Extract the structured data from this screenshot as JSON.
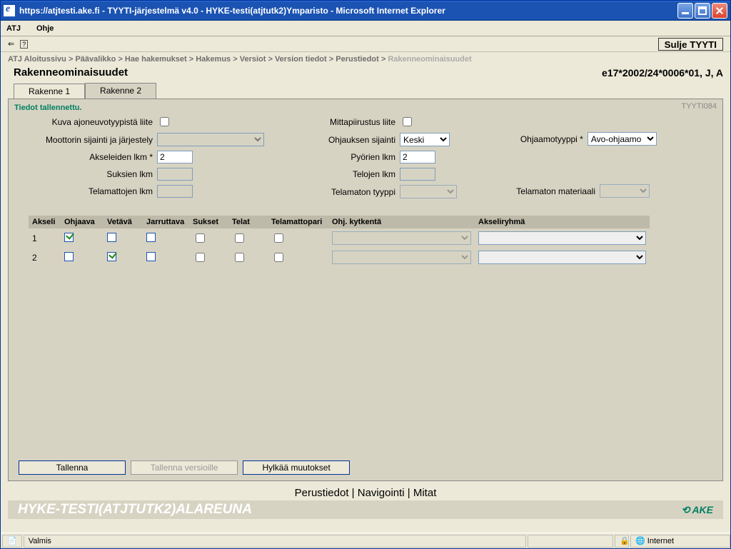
{
  "window_title": "https://atjtesti.ake.fi - TYYTI-järjestelmä v4.0 - HYKE-testi(atjtutk2)Ymparisto - Microsoft Internet Explorer",
  "menu": {
    "atj": "ATJ",
    "ohje": "Ohje"
  },
  "sulje": "Sulje TYYTI",
  "crumb": [
    "ATJ Aloitussivu",
    "Päävalikko",
    "Hae hakemukset",
    "Hakemus",
    "Versiot",
    "Version tiedot",
    "Perustiedot",
    "Rakenneominaisuudet"
  ],
  "title": "Rakenneominaisuudet",
  "title_right": "e17*2002/24*0006*01, J, A",
  "tabs": {
    "t1": "Rakenne 1",
    "t2": "Rakenne 2"
  },
  "panel_id": "TYYTI084",
  "saved_msg": "Tiedot tallennettu.",
  "f": {
    "kuva": "Kuva ajoneuvotyypistä liite",
    "moottori": "Moottorin sijainti ja järjestely",
    "aks": "Akseleiden lkm *",
    "aks_v": "2",
    "suk": "Suksien lkm",
    "tel": "Telamattojen lkm",
    "mitta": "Mittapiirustus liite",
    "ohj": "Ohjauksen sijainti",
    "ohj_v": "Keski",
    "pyo": "Pyörien lkm",
    "pyo_v": "2",
    "telj": "Telojen lkm",
    "teltyp": "Telamaton tyyppi",
    "ohjtyp": "Ohjaamotyyppi *",
    "ohjtyp_v": "Avo-ohjaamo",
    "telmat": "Telamaton materiaali"
  },
  "th": {
    "a": "Akseli",
    "o": "Ohjaava",
    "v": "Vetävä",
    "j": "Jarruttava",
    "s": "Sukset",
    "t": "Telat",
    "tp": "Telamattopari",
    "ok": "Ohj. kytkentä",
    "ar": "Akseliryhmä"
  },
  "rows": [
    {
      "n": "1",
      "o": true,
      "v": false,
      "j": false,
      "s": false,
      "t": false,
      "tp": false
    },
    {
      "n": "2",
      "o": false,
      "v": true,
      "j": false,
      "s": false,
      "t": false,
      "tp": false
    }
  ],
  "btns": {
    "save": "Tallenna",
    "savev": "Tallenna versioille",
    "reject": "Hylkää muutokset"
  },
  "nav": {
    "p": "Perustiedot",
    "n": "Navigointi",
    "m": "Mitat"
  },
  "footer": "HYKE-TESTI(ATJTUTK2)ALAREUNA",
  "ake": "AKE",
  "status": {
    "ready": "Valmis",
    "zone": "Internet"
  }
}
